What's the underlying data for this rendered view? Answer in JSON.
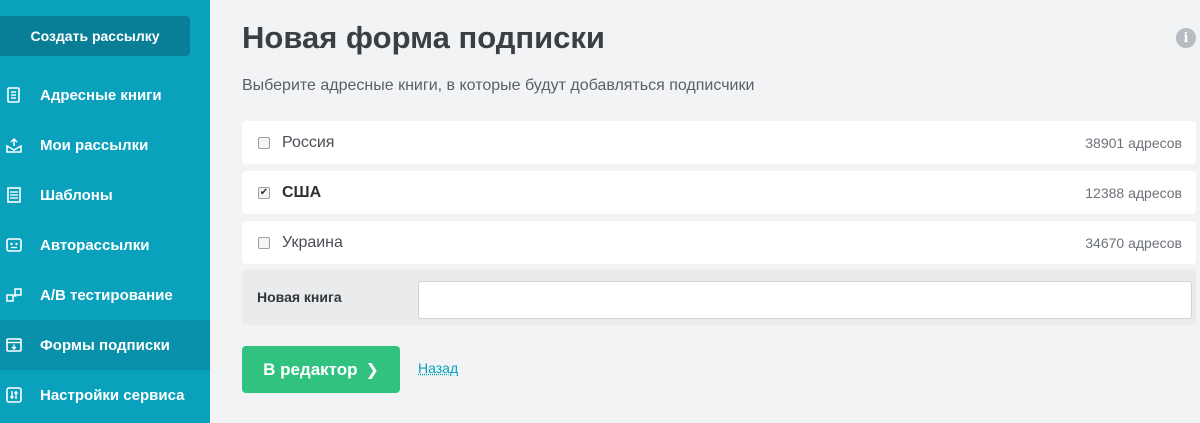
{
  "sidebar": {
    "create_label": "Создать рассылку",
    "items": [
      {
        "label": "Адресные книги",
        "icon": "address-book-icon"
      },
      {
        "label": "Мои рассылки",
        "icon": "mailing-icon"
      },
      {
        "label": "Шаблоны",
        "icon": "templates-icon"
      },
      {
        "label": "Авторассылки",
        "icon": "automation-icon"
      },
      {
        "label": "A/B тестирование",
        "icon": "ab-test-icon"
      },
      {
        "label": "Формы подписки",
        "icon": "subscription-form-icon",
        "active": true
      },
      {
        "label": "Настройки сервиса",
        "icon": "settings-sliders-icon"
      }
    ],
    "colors": {
      "bg": "#0aa1bd",
      "button": "#087f96",
      "active": "#0990ab"
    }
  },
  "main": {
    "title": "Новая форма подписки",
    "subtitle": "Выберите адресные книги, в которые будут добавляться подписчики",
    "info_icon": "info-icon",
    "books": [
      {
        "name": "Россия",
        "count": "38901 адресов",
        "checked": false
      },
      {
        "name": "США",
        "count": "12388 адресов",
        "checked": true
      },
      {
        "name": "Украина",
        "count": "34670 адресов",
        "checked": false
      }
    ],
    "new_book": {
      "label": "Новая книга",
      "value": "",
      "placeholder": ""
    },
    "editor_button": "В редактор",
    "back_link": "Назад",
    "colors": {
      "primary_btn": "#32c27f",
      "link": "#0aa1bd"
    }
  }
}
